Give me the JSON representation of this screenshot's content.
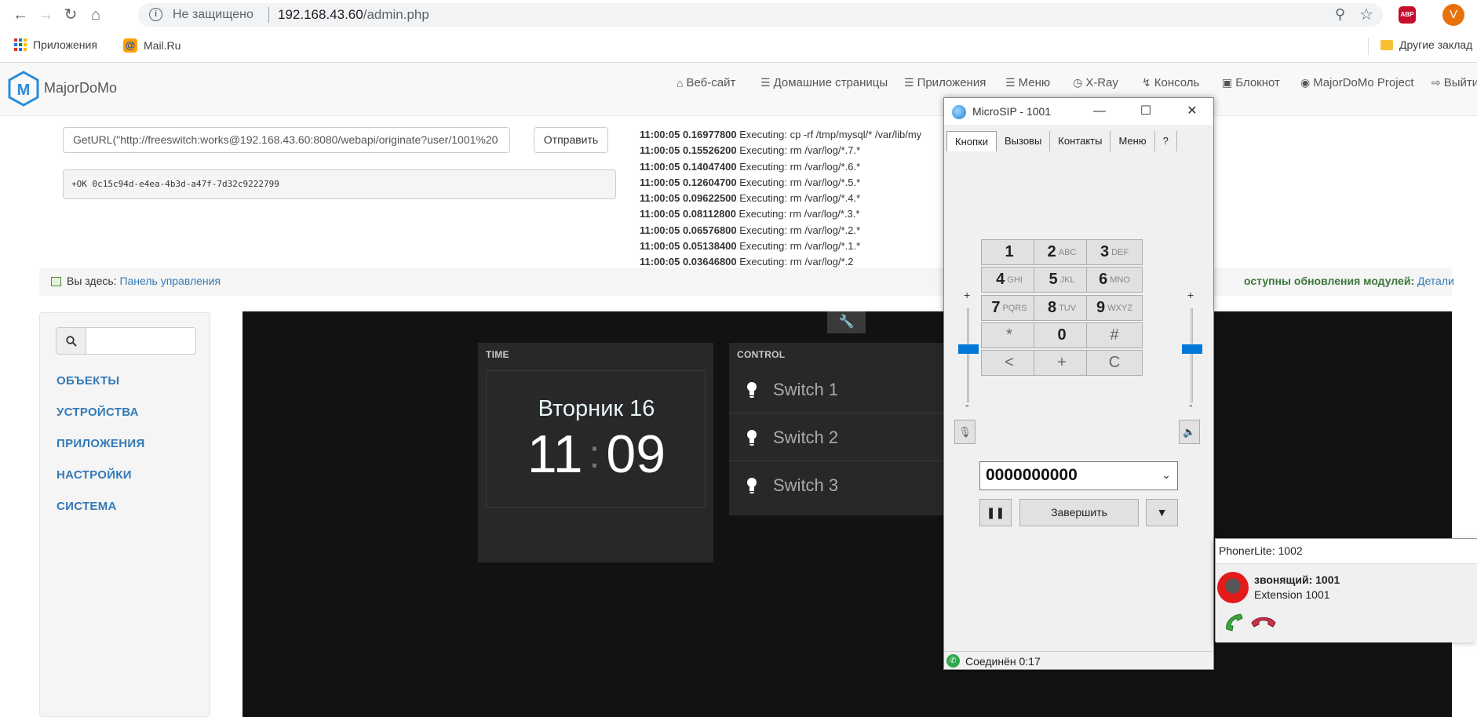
{
  "browser": {
    "insecure_label": "Не защищено",
    "url_host": "192.168.43.60",
    "url_path": "/admin.php",
    "avatar_letter": "V",
    "abp_label": "ABP",
    "bookmarks": [
      "Приложения",
      "Mail.Ru"
    ],
    "other_bookmarks": "Другие заклад"
  },
  "navbar": {
    "brand": "MajorDoMo",
    "links": [
      "Веб-сайт",
      "Домашние страницы",
      "Приложения",
      "Меню",
      "X-Ray",
      "Консоль",
      "Блокнот",
      "MajorDoMo Project",
      "Выйти"
    ]
  },
  "console": {
    "command": "GetURL(\"http://freeswitch:works@192.168.43.60:8080/webapi/originate?user/1001%20",
    "send_label": "Отправить",
    "result": "+OK 0c15c94d-e4ea-4b3d-a47f-7d32c9222799",
    "log": [
      {
        "time": "11:00:05",
        "dur": "0.16977800",
        "text": "Executing: cp -rf /tmp/mysql/* /var/lib/my"
      },
      {
        "time": "11:00:05",
        "dur": "0.15526200",
        "text": "Executing: rm /var/log/*.7.*"
      },
      {
        "time": "11:00:05",
        "dur": "0.14047400",
        "text": "Executing: rm /var/log/*.6.*"
      },
      {
        "time": "11:00:05",
        "dur": "0.12604700",
        "text": "Executing: rm /var/log/*.5.*"
      },
      {
        "time": "11:00:05",
        "dur": "0.09622500",
        "text": "Executing: rm /var/log/*.4.*"
      },
      {
        "time": "11:00:05",
        "dur": "0.08112800",
        "text": "Executing: rm /var/log/*.3.*"
      },
      {
        "time": "11:00:05",
        "dur": "0.06576800",
        "text": "Executing: rm /var/log/*.2.*"
      },
      {
        "time": "11:00:05",
        "dur": "0.05138400",
        "text": "Executing: rm /var/log/*.1.*"
      },
      {
        "time": "11:00:05",
        "dur": "0.03646800",
        "text": "Executing: rm /var/log/*.2"
      }
    ]
  },
  "breadcrumb": {
    "prefix": "Вы здесь:",
    "link": "Панель управления",
    "updates": "оступны обновления модулей:",
    "details": "Детали"
  },
  "sidebar": {
    "items": [
      "ОБЪЕКТЫ",
      "УСТРОЙСТВА",
      "ПРИЛОЖЕНИЯ",
      "НАСТРОЙКИ",
      "СИСТЕМА"
    ]
  },
  "dashboard": {
    "time_title": "TIME",
    "day": "Вторник 16",
    "hours": "11",
    "colon": ":",
    "minutes": "09",
    "control_title": "CONTROL",
    "switches": [
      "Switch 1",
      "Switch 2",
      "Switch 3"
    ]
  },
  "microsip": {
    "title": "MicroSIP - 1001",
    "tabs": [
      "Кнопки",
      "Вызовы",
      "Контакты",
      "Меню",
      "?"
    ],
    "keys": [
      {
        "n": "1",
        "l": ""
      },
      {
        "n": "2",
        "l": "ABC"
      },
      {
        "n": "3",
        "l": "DEF"
      },
      {
        "n": "4",
        "l": "GHI"
      },
      {
        "n": "5",
        "l": "JKL"
      },
      {
        "n": "6",
        "l": "MNO"
      },
      {
        "n": "7",
        "l": "PQRS"
      },
      {
        "n": "8",
        "l": "TUV"
      },
      {
        "n": "9",
        "l": "WXYZ"
      },
      {
        "n": "*",
        "l": ""
      },
      {
        "n": "0",
        "l": ""
      },
      {
        "n": "#",
        "l": ""
      },
      {
        "n": "<",
        "l": ""
      },
      {
        "n": "+",
        "l": ""
      },
      {
        "n": "C",
        "l": ""
      }
    ],
    "vol_plus": "+",
    "vol_minus": "-",
    "number": "0000000000",
    "hangup_label": "Завершить",
    "status": "Соединён 0:17"
  },
  "phonerlite": {
    "title": "PhonerLite: 1002",
    "caller": "звонящий: 1001",
    "extension": "Extension 1001"
  }
}
